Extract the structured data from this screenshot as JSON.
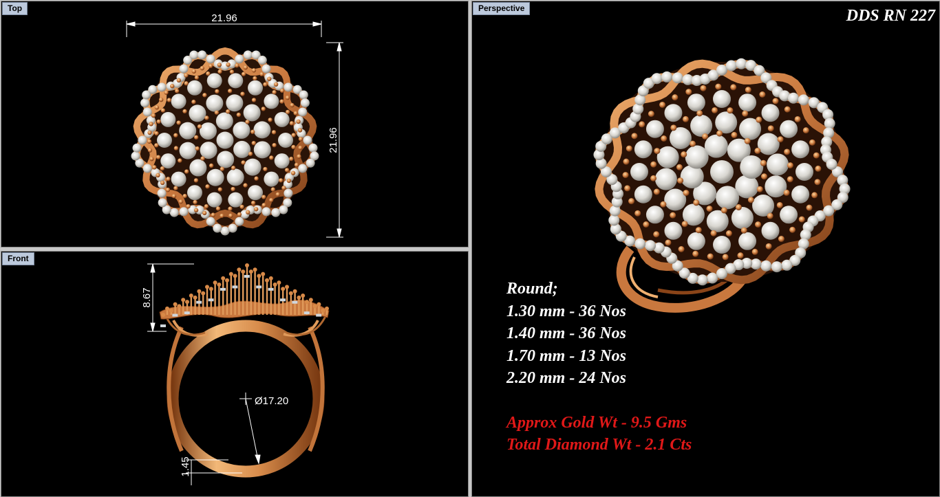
{
  "viewports": {
    "top": {
      "label": "Top",
      "width_dim": "21.96",
      "height_dim": "21.96"
    },
    "front": {
      "label": "Front",
      "height_dim": "8.67",
      "diameter_dim": "Ø17.20",
      "band_dim": "1.45"
    },
    "perspective": {
      "label": "Perspective"
    }
  },
  "design_code": "DDS RN 227",
  "specs": {
    "heading": "Round;",
    "stones": [
      "1.30 mm - 36 Nos",
      "1.40 mm - 36 Nos",
      "1.70 mm - 13 Nos",
      "2.20 mm - 24 Nos"
    ],
    "gold_weight": "Approx Gold Wt - 9.5 Gms",
    "diamond_weight": "Total Diamond Wt - 2.1 Cts"
  },
  "colors": {
    "gold": "#c9783e",
    "gold_light": "#f0b070",
    "gold_dark": "#6a3412",
    "diamond": "#e8e6e0",
    "note_red": "#e01818"
  }
}
